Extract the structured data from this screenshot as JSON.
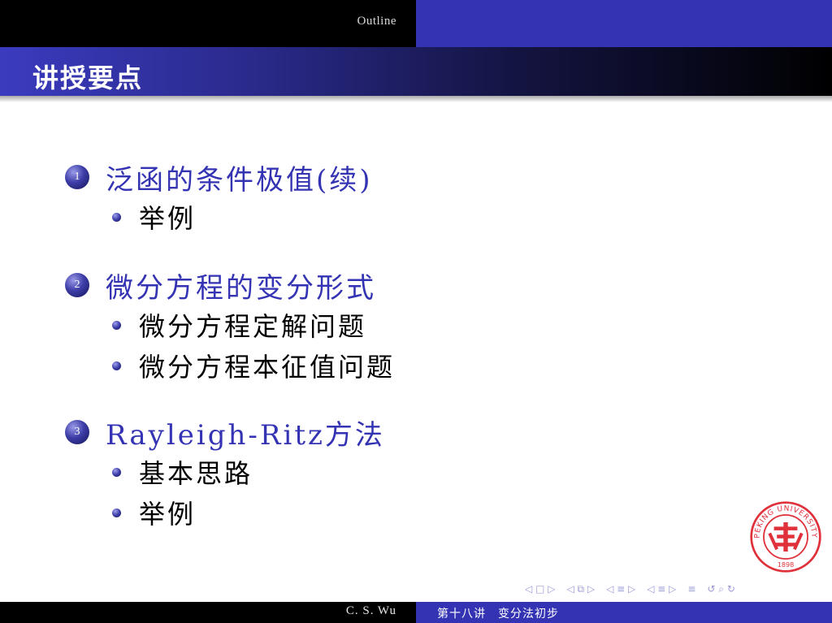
{
  "header": {
    "section_label": "Outline"
  },
  "title": "讲授要点",
  "sections": [
    {
      "number": "1",
      "title": "泛函的条件极值(续)",
      "items": [
        "举例"
      ]
    },
    {
      "number": "2",
      "title": "微分方程的变分形式",
      "items": [
        "微分方程定解问题",
        "微分方程本征值问题"
      ]
    },
    {
      "number": "3",
      "title": "Rayleigh-Ritz方法",
      "items": [
        "基本思路",
        "举例"
      ]
    }
  ],
  "footer": {
    "author": "C. S. Wu",
    "lecture": "第十八讲　变分法初步"
  },
  "logo": {
    "text_top": "PEKING UNIVERSITY",
    "year": "1898",
    "icon": "peking-university-seal"
  },
  "nav": {
    "frame": "◁ □ ▷",
    "subsection": "◁ ⧉ ▷",
    "section": "◁ ≡ ▷",
    "part": "◁ ≡ ▷",
    "toc": "≡",
    "search": "↺ ⌕ ↻"
  },
  "colors": {
    "accent": "#3333b3",
    "header_dark": "#000000",
    "seal": "#e0303a"
  }
}
